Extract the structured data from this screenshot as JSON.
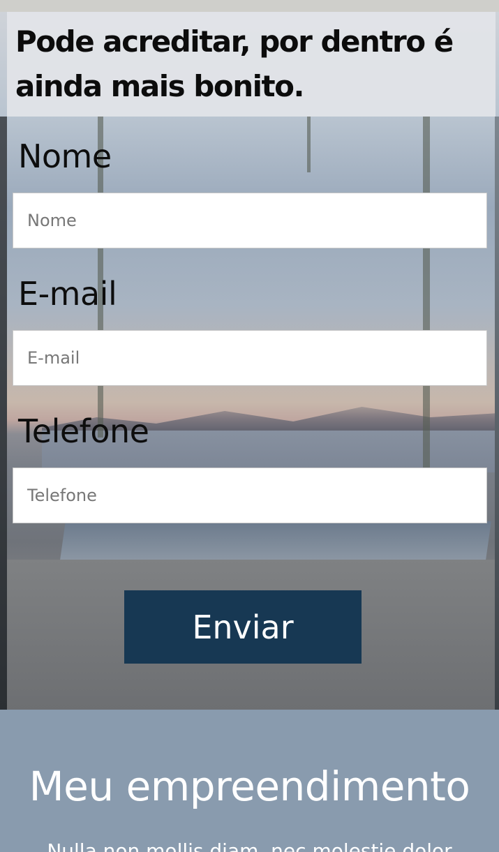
{
  "headline": "Pode acreditar, por dentro é ainda mais bonito.",
  "form": {
    "nome_label": "Nome",
    "nome_placeholder": "Nome",
    "email_label": "E-mail",
    "email_placeholder": "E-mail",
    "telefone_label": "Telefone",
    "telefone_placeholder": "Telefone",
    "submit_label": "Enviar"
  },
  "section": {
    "title": "Meu empreendimento",
    "text": "Nulla non mollis diam, nec molestie dolor"
  },
  "colors": {
    "button": "#173853",
    "section_bg": "#899bae"
  }
}
